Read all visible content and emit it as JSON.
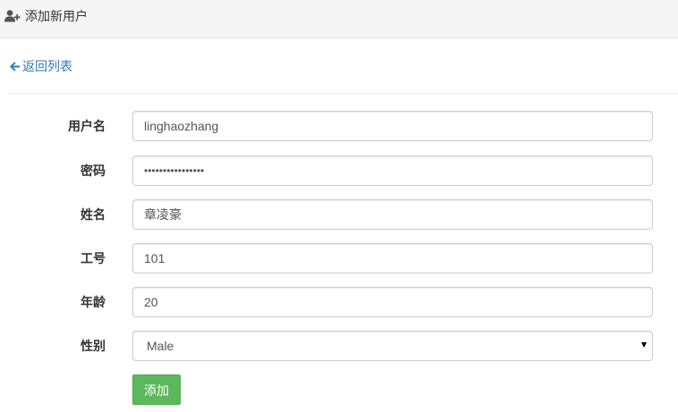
{
  "header": {
    "icon": "user-plus-icon",
    "title": "添加新用户"
  },
  "nav": {
    "back_icon": "arrow-left-icon",
    "back_label": "返回列表",
    "link_color": "#337ab7"
  },
  "form": {
    "username": {
      "label": "用户名",
      "value": "linghaozhang"
    },
    "password": {
      "label": "密码",
      "value": "••••••••••••••••"
    },
    "name": {
      "label": "姓名",
      "value": "章凌豪"
    },
    "employee_id": {
      "label": "工号",
      "value": "101"
    },
    "age": {
      "label": "年龄",
      "value": "20"
    },
    "gender": {
      "label": "性别",
      "selected": "Male"
    },
    "submit_label": "添加",
    "submit_color": "#5cb85c"
  }
}
